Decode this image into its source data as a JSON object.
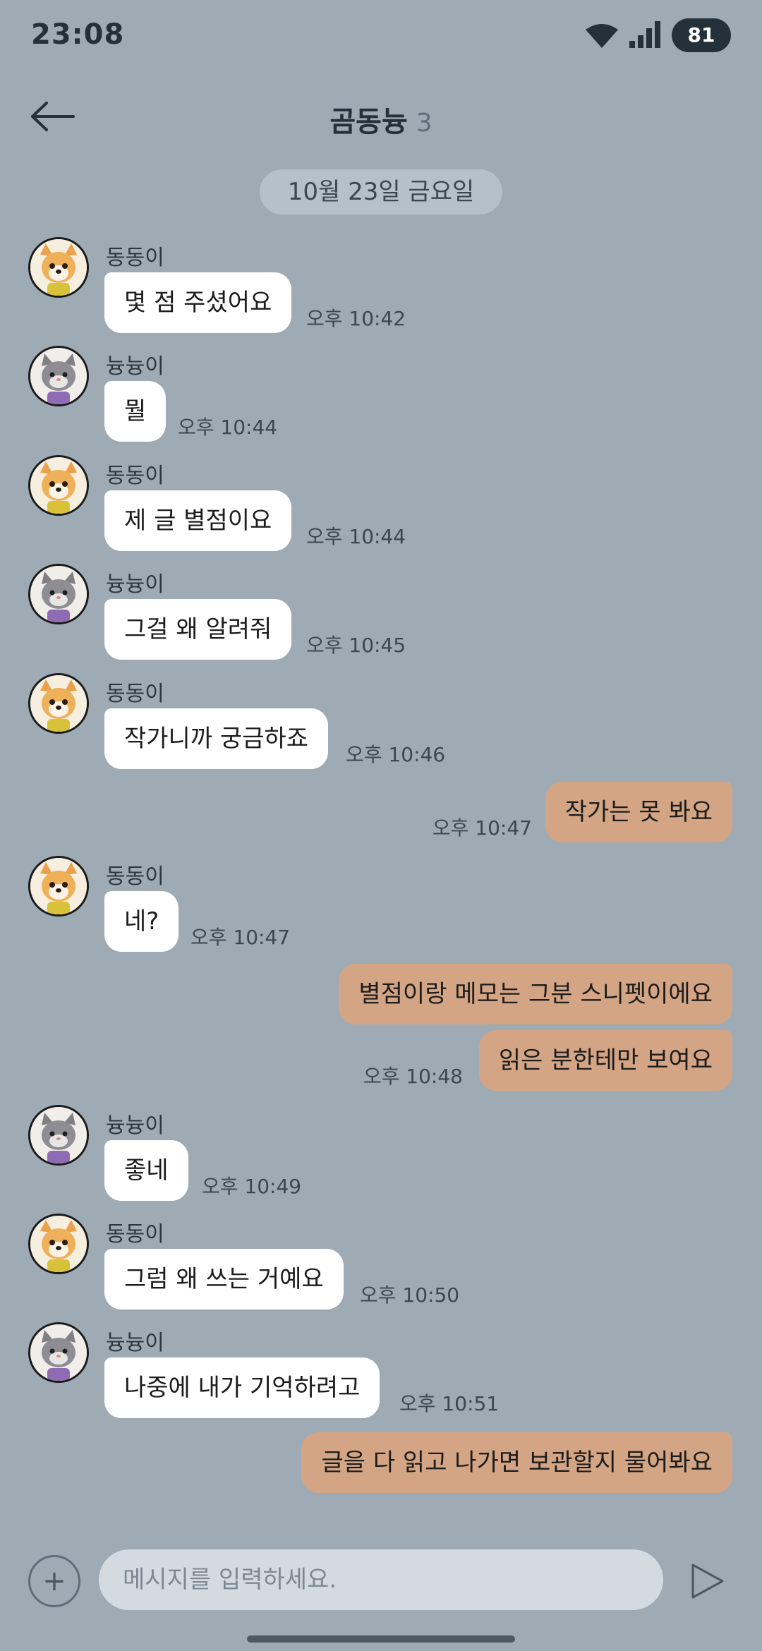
{
  "status_bar": {
    "time": "23:08",
    "battery": "81"
  },
  "header": {
    "title": "곰동늉",
    "member_count": "3",
    "back_icon": "arrow-left-icon"
  },
  "date_divider": "10월 23일 금요일",
  "messages": [
    {
      "side": "in",
      "sender": "동동이",
      "avatar": "dog",
      "text": "몇 점 주셨어요",
      "time": "오후 10:42"
    },
    {
      "side": "in",
      "sender": "늉늉이",
      "avatar": "cat",
      "text": "뭘",
      "time": "오후 10:44"
    },
    {
      "side": "in",
      "sender": "동동이",
      "avatar": "dog",
      "text": "제 글 별점이요",
      "time": "오후 10:44"
    },
    {
      "side": "in",
      "sender": "늉늉이",
      "avatar": "cat",
      "text": "그걸 왜 알려줘",
      "time": "오후 10:45"
    },
    {
      "side": "in",
      "sender": "동동이",
      "avatar": "dog",
      "text": "작가니까 궁금하죠",
      "time": "오후 10:46"
    },
    {
      "side": "out",
      "text": "작가는 못 봐요",
      "time": "오후 10:47"
    },
    {
      "side": "in",
      "sender": "동동이",
      "avatar": "dog",
      "text": "네?",
      "time": "오후 10:47"
    },
    {
      "side": "out",
      "text": "별점이랑 메모는 그분 스니펫이에요",
      "time": ""
    },
    {
      "side": "out",
      "text": "읽은 분한테만 보여요",
      "time": "오후 10:48"
    },
    {
      "side": "in",
      "sender": "늉늉이",
      "avatar": "cat",
      "text": "좋네",
      "time": "오후 10:49"
    },
    {
      "side": "in",
      "sender": "동동이",
      "avatar": "dog",
      "text": "그럼 왜 쓰는 거예요",
      "time": "오후 10:50"
    },
    {
      "side": "in",
      "sender": "늉늉이",
      "avatar": "cat",
      "text": "나중에 내가 기억하려고",
      "time": "오후 10:51"
    },
    {
      "side": "out",
      "text": "글을 다 읽고 나가면 보관할지 물어봐요",
      "time": ""
    }
  ],
  "composer": {
    "placeholder": "메시지를 입력하세요.",
    "value": "",
    "plus_icon": "plus-icon",
    "send_icon": "send-icon"
  },
  "colors": {
    "background": "#9eabb5",
    "incoming_bubble": "#ffffff",
    "outgoing_bubble": "#d3a584",
    "text_dark": "#24313b"
  }
}
